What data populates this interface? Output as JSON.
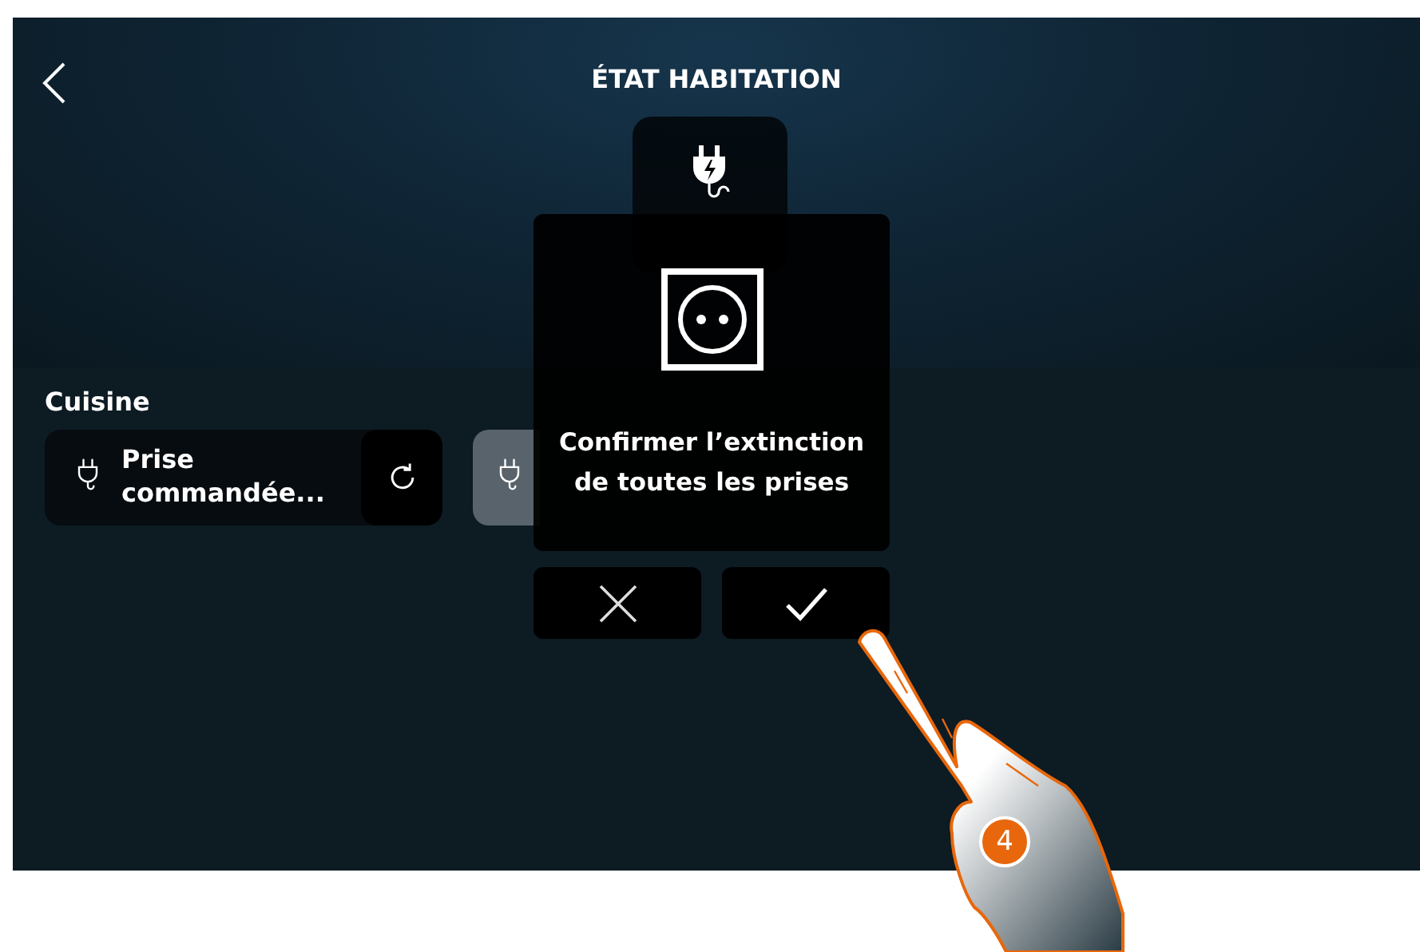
{
  "header": {
    "title": "ÉTAT HABITATION"
  },
  "room": {
    "name": "Cuisine",
    "devices": [
      {
        "kind": "active",
        "name": "Prise commandée..."
      },
      {
        "kind": "faded"
      }
    ]
  },
  "dialog": {
    "message": "Confirmer l’extinction de toutes les prises",
    "buttons": [
      {
        "kind": "cancel"
      },
      {
        "kind": "confirm"
      }
    ]
  },
  "step_badge": "4"
}
